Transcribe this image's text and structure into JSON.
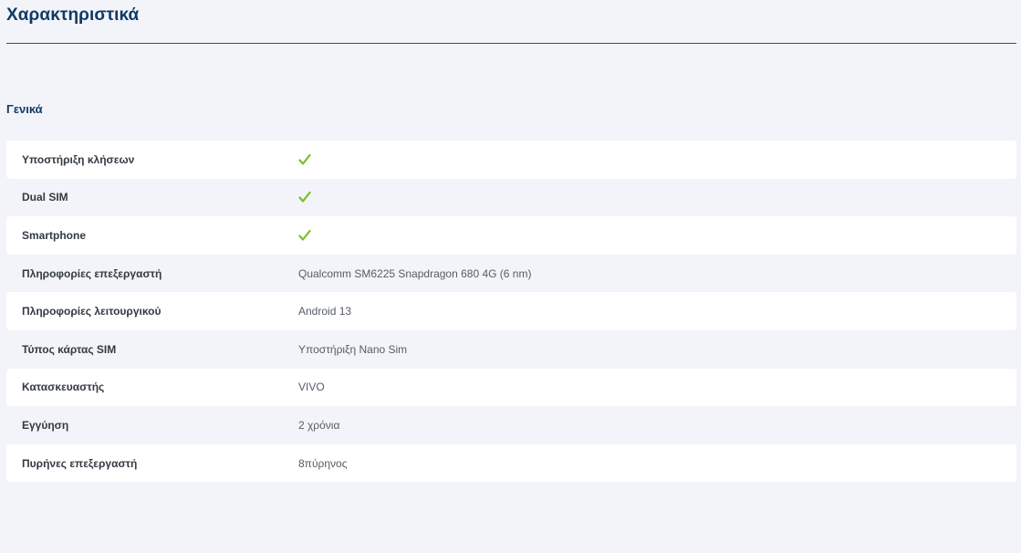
{
  "page": {
    "title": "Χαρακτηριστικά"
  },
  "section": {
    "title": "Γενικά"
  },
  "colors": {
    "accent": "#0f3a66",
    "check": "#7cbd2a",
    "background": "#f3f4f9"
  },
  "specs": [
    {
      "label": "Υποστήριξη κλήσεων",
      "value": "",
      "icon": "check-icon"
    },
    {
      "label": "Dual SIM",
      "value": "",
      "icon": "check-icon"
    },
    {
      "label": "Smartphone",
      "value": "",
      "icon": "check-icon"
    },
    {
      "label": "Πληροφορίες επεξεργαστή",
      "value": "Qualcomm SM6225 Snapdragon 680 4G (6 nm)"
    },
    {
      "label": "Πληροφορίες λειτουργικού",
      "value": "Android 13"
    },
    {
      "label": "Τύπος κάρτας SIM",
      "value": "Υποστήριξη Nano Sim"
    },
    {
      "label": "Κατασκευαστής",
      "value": "VIVO"
    },
    {
      "label": "Εγγύηση",
      "value": "2 χρόνια"
    },
    {
      "label": "Πυρήνες επεξεργαστή",
      "value": "8πύρηνος"
    }
  ]
}
